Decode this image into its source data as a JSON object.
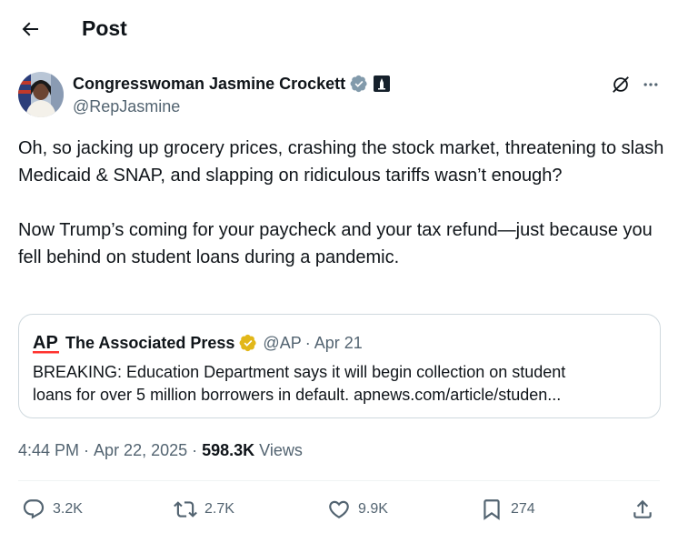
{
  "header": {
    "title": "Post"
  },
  "tweet": {
    "author": {
      "name": "Congresswoman Jasmine Crockett",
      "handle": "@RepJasmine",
      "avatar": "avatar-photo"
    },
    "text": "Oh, so jacking up grocery prices, crashing the stock market, threatening to slash Medicaid & SNAP, and slapping on ridiculous tariffs wasn’t enough?\n\nNow Trump’s coming for your paycheck and your tax refund—just because you fell behind on student loans during a pandemic.",
    "quote": {
      "logo_text": "AP",
      "name": "The Associated Press",
      "handle": "@AP",
      "separator": "·",
      "date": "Apr 21",
      "body_line1": "BREAKING: Education Department says it will begin collection on student",
      "body_line2": "loans for over 5 million borrowers in default. apnews.com/article/studen..."
    },
    "meta": {
      "time": "4:44 PM",
      "separator": "·",
      "date": "Apr 22, 2025",
      "views_count": "598.3K",
      "views_label": "Views"
    },
    "actions": {
      "reply": "3.2K",
      "repost": "2.7K",
      "like": "9.9K",
      "bookmark": "274"
    }
  },
  "colors": {
    "text": "#0f1419",
    "secondary": "#536471",
    "verified_blue": "#1d9bf0",
    "verified_gold": "#e2b719",
    "ap_red": "#ff322e",
    "border": "#cfd9de"
  }
}
